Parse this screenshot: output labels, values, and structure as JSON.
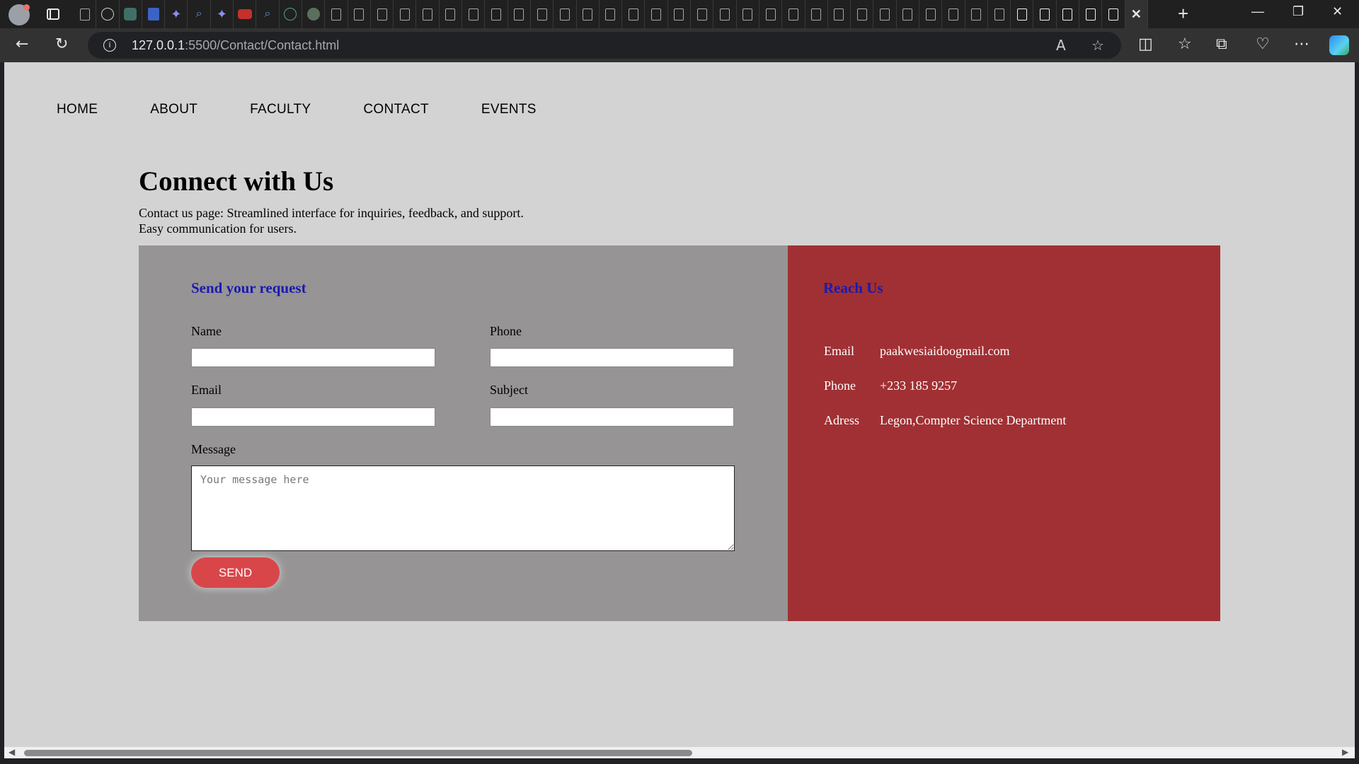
{
  "browser": {
    "url_host": "127.0.0.1",
    "url_path": ":5500/Contact/Contact.html"
  },
  "nav": {
    "items": [
      "HOME",
      "ABOUT",
      "FACULTY",
      "CONTACT",
      "EVENTS"
    ]
  },
  "page": {
    "heading": "Connect with Us",
    "intro_line1": "Contact us page: Streamlined interface for inquiries, feedback, and support.",
    "intro_line2": "Easy communication for users."
  },
  "form": {
    "title": "Send your request",
    "name_label": "Name",
    "phone_label": "Phone",
    "email_label": "Email",
    "subject_label": "Subject",
    "message_label": "Message",
    "message_placeholder": "Your message here",
    "send_label": "SEND"
  },
  "reach": {
    "title": "Reach Us",
    "rows": [
      {
        "label": "Email",
        "value": "paakwesiaidoogmail.com"
      },
      {
        "label": "Phone",
        "value": "+233 185 9257"
      },
      {
        "label": "Adress",
        "value": "Legon,Compter Science Department"
      }
    ]
  },
  "colors": {
    "page_bg": "#d3d3d3",
    "form_panel": "#969495",
    "reach_panel": "#a03033",
    "section_title": "#1a1ab0",
    "send_button": "#d8464a"
  }
}
